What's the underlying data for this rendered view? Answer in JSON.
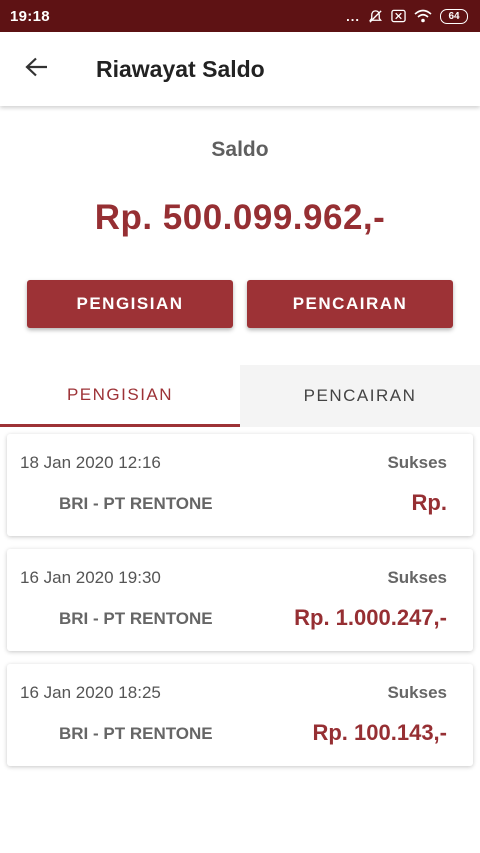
{
  "status_bar": {
    "time": "19:18",
    "dots": "...",
    "battery": "64",
    "icons": [
      "bell-off-icon",
      "close-box-icon",
      "wifi-icon",
      "battery-icon"
    ]
  },
  "app_bar": {
    "title": "Riawayat Saldo",
    "back_icon": "arrow-left-icon"
  },
  "balance": {
    "label": "Saldo",
    "amount": "Rp. 500.099.962,-"
  },
  "actions": {
    "topup_label": "PENGISIAN",
    "withdraw_label": "PENCAIRAN"
  },
  "tabs": [
    {
      "label": "PENGISIAN",
      "active": true
    },
    {
      "label": "PENCAIRAN",
      "active": false
    }
  ],
  "history": [
    {
      "date": "18 Jan 2020 12:16",
      "status": "Sukses",
      "bank": "BRI - PT RENTONE",
      "amount": "Rp."
    },
    {
      "date": "16 Jan 2020 19:30",
      "status": "Sukses",
      "bank": "BRI - PT RENTONE",
      "amount": "Rp. 1.000.247,-"
    },
    {
      "date": "16 Jan 2020 18:25",
      "status": "Sukses",
      "bank": "BRI - PT RENTONE",
      "amount": "Rp. 100.143,-"
    }
  ],
  "colors": {
    "status_bar": "#5e1214",
    "primary": "#9d3236",
    "amount_text": "#962f33"
  }
}
